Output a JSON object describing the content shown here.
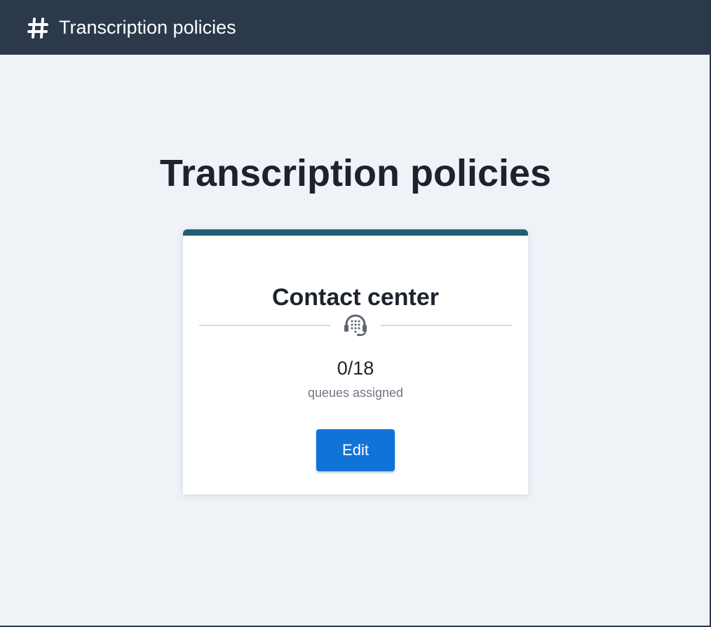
{
  "header": {
    "icon": "hash-icon",
    "title": "Transcription policies",
    "background": "#2b394b"
  },
  "page": {
    "title": "Transcription policies",
    "background": "#eff3f8"
  },
  "policy_card": {
    "accent_color": "#235e74",
    "title": "Contact center",
    "icon": "headset-icon",
    "assigned_count": "0/18",
    "assigned_label": "queues assigned",
    "edit_label": "Edit",
    "button_color": "#0f73d8"
  }
}
